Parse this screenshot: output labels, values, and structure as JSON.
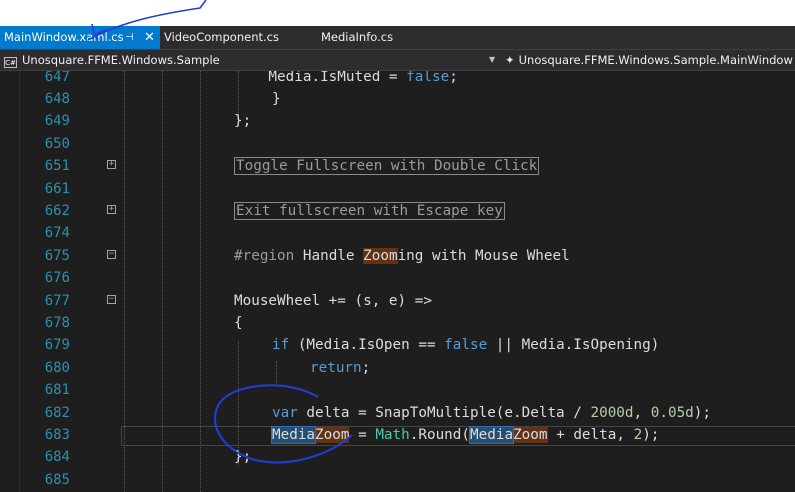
{
  "tabs": [
    {
      "label": "MainWindow.xaml.cs",
      "pin": "⊣",
      "close": "✕"
    },
    {
      "label": "VideoComponent.cs"
    },
    {
      "label": "MediaInfo.cs"
    }
  ],
  "nav": {
    "project_icon": "C#",
    "project": "Unosquare.FFME.Windows.Sample",
    "class_icon": "✦",
    "class": "Unosquare.FFME.Windows.Sample.MainWindow"
  },
  "code": {
    "lines": [
      {
        "num": "647"
      },
      {
        "num": "648"
      },
      {
        "num": "649"
      },
      {
        "num": "650"
      },
      {
        "num": "651"
      },
      {
        "num": "661"
      },
      {
        "num": "662"
      },
      {
        "num": "674"
      },
      {
        "num": "675"
      },
      {
        "num": "676"
      },
      {
        "num": "677"
      },
      {
        "num": "678"
      },
      {
        "num": "679"
      },
      {
        "num": "680"
      },
      {
        "num": "681"
      },
      {
        "num": "682"
      },
      {
        "num": "683"
      },
      {
        "num": "684"
      },
      {
        "num": "685"
      }
    ],
    "t647a": "    Media.IsMuted = ",
    "t647b": "false",
    "t647c": ";",
    "t648": "}",
    "t649": "};",
    "t651": "Toggle Fullscreen with Double Click",
    "t662": "Exit fullscreen with Escape key",
    "t675a": "#region",
    "t675b": " Handle ",
    "t675c": "Zoom",
    "t675d": "ing with Mouse Wheel",
    "t677": "MouseWheel += (s, e) =>",
    "t678": "{",
    "t679a": "if",
    "t679b": " (Media.IsOpen == ",
    "t679c": "false",
    "t679d": " || Media.IsOpening)",
    "t680a": "return",
    "t680b": ";",
    "t682a": "var",
    "t682b": " delta = SnapToMultiple(e.Delta / ",
    "t682c": "2000d",
    "t682d": ", ",
    "t682e": "0.05d",
    "t682f": ");",
    "t683a": "Media",
    "t683b": "Zoom",
    "t683c": " = ",
    "t683d": "Math",
    "t683e": ".Round(",
    "t683f": "Media",
    "t683g": "Zoom",
    "t683h": " + delta, ",
    "t683i": "2",
    "t683j": ");",
    "t684": "};",
    "fold_plus": "+",
    "fold_minus": "−"
  },
  "colors": {
    "active_tab": "#007acc",
    "annotation_ink": "#1f3fd6",
    "line_number": "#2b91af",
    "keyword": "#569cd6"
  }
}
